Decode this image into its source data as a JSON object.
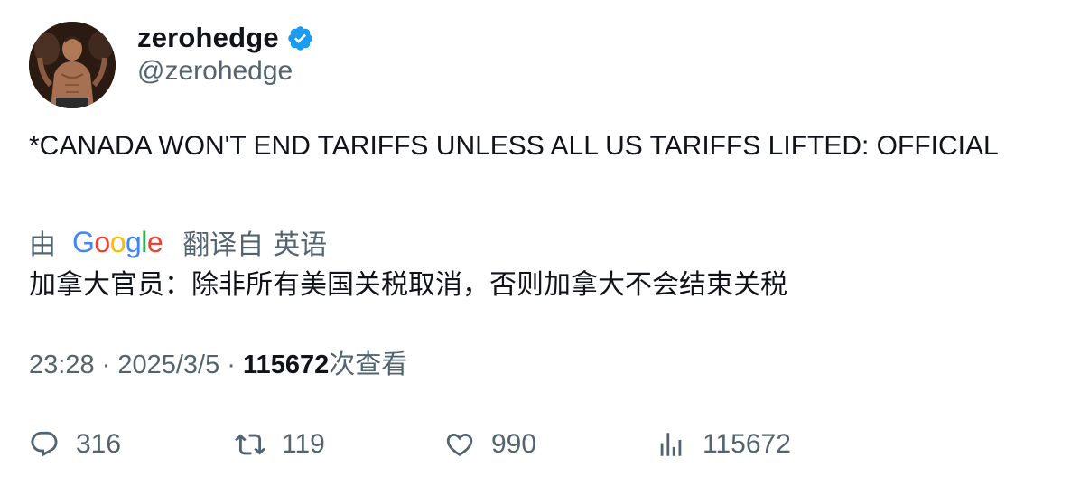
{
  "author": {
    "display_name": "zerohedge",
    "handle": "@zerohedge",
    "verified": true,
    "avatar_icon": "avatar-photo"
  },
  "tweet": {
    "text": "*CANADA WON'T END TARIFFS UNLESS ALL US TARIFFS LIFTED: OFFICIAL"
  },
  "translation": {
    "by_label": "由",
    "provider": "Google",
    "from_label": "翻译自",
    "language": "英语",
    "text": "加拿大官员：除非所有美国关税取消，否则加拿大不会结束关税"
  },
  "meta": {
    "time": "23:28",
    "separator": " · ",
    "date": "2025/3/5",
    "views_count": "115672",
    "views_label": "次查看"
  },
  "actions": {
    "replies": "316",
    "retweets": "119",
    "likes": "990",
    "views": "115672"
  },
  "colors": {
    "text_primary": "#0f1419",
    "text_secondary": "#536471",
    "verified_blue": "#1d9bf0"
  }
}
